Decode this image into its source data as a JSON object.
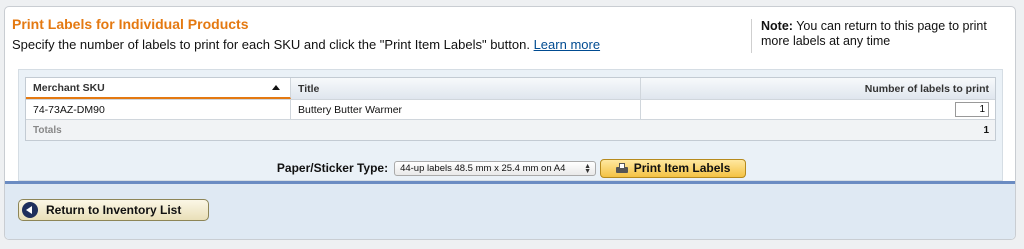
{
  "header": {
    "title": "Print Labels for Individual Products",
    "description": "Specify the number of labels to print for each SKU and click the \"Print Item Labels\" button.",
    "learn_more": "Learn more"
  },
  "note": {
    "label": "Note:",
    "text": "You can return to this page to print more labels at any time"
  },
  "table": {
    "columns": [
      "Merchant SKU",
      "Title",
      "Number of labels to print"
    ],
    "rows": [
      {
        "sku": "74-73AZ-DM90",
        "title": "Buttery Butter Warmer",
        "count": "1"
      }
    ],
    "totals_label": "Totals",
    "totals_value": "1"
  },
  "paper": {
    "label": "Paper/Sticker Type:",
    "selected": "44-up labels 48.5 mm x 25.4 mm on A4"
  },
  "buttons": {
    "print": "Print Item Labels",
    "return": "Return to Inventory List"
  },
  "colors": {
    "accent": "#e47911",
    "link": "#004b91",
    "bar": "#6b8cc2"
  }
}
